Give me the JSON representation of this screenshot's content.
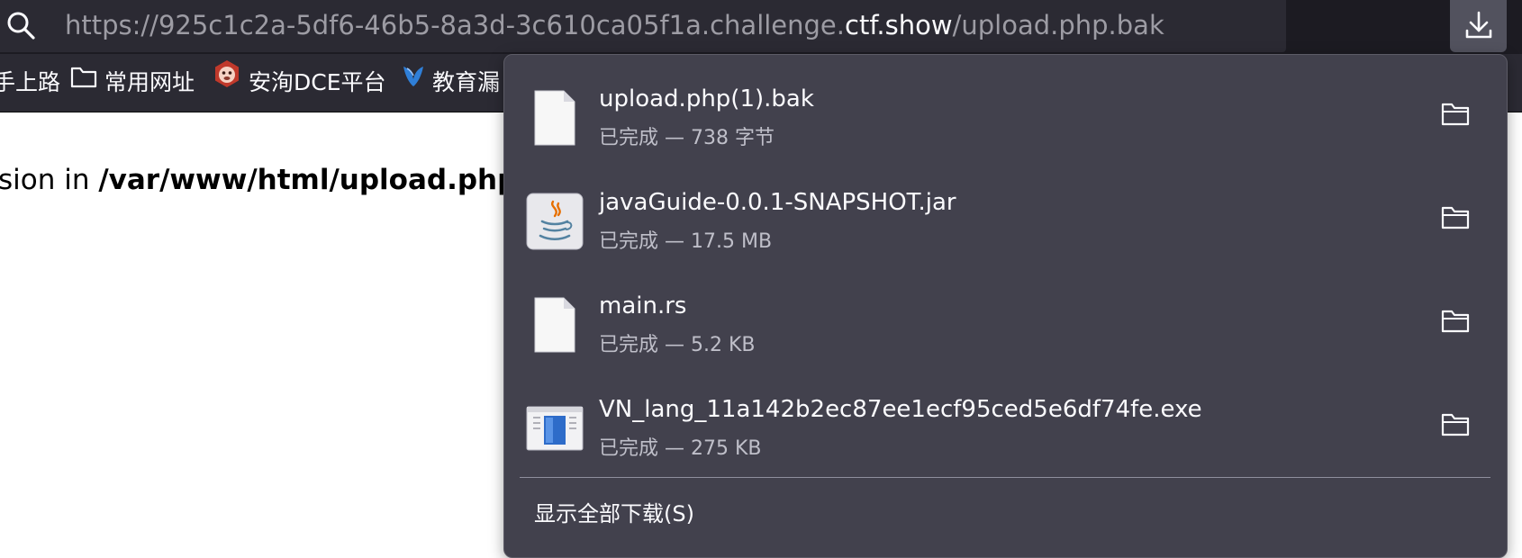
{
  "toolbar": {
    "url_prefix": "https://925c1c2a-5df6-46b5-8a3d-3c610ca05f1a.challenge.",
    "url_host": "ctf.show",
    "url_suffix": "/upload.php.bak"
  },
  "bookmarks": [
    {
      "label": "手上路",
      "icon": "none"
    },
    {
      "label": "常用网址",
      "icon": "folder-icon"
    },
    {
      "label": "安洵DCE平台",
      "icon": "monkey-logo-icon"
    },
    {
      "label": "教育漏",
      "icon": "shield-bird-icon"
    }
  ],
  "page": {
    "prefix": "sion in ",
    "path": "/var/www/html/upload.php"
  },
  "downloads": {
    "items": [
      {
        "name": "upload.php(1).bak",
        "status": "已完成 — 738 字节",
        "icon": "generic-file-icon"
      },
      {
        "name": "javaGuide-0.0.1-SNAPSHOT.jar",
        "status": "已完成 — 17.5 MB",
        "icon": "java-file-icon"
      },
      {
        "name": "main.rs",
        "status": "已完成 — 5.2 KB",
        "icon": "generic-file-icon"
      },
      {
        "name": "VN_lang_11a142b2ec87ee1ecf95ced5e6df74fe.exe",
        "status": "已完成 — 275 KB",
        "icon": "exe-file-icon"
      }
    ],
    "show_all": "显示全部下载(S)"
  },
  "colors": {
    "toolbar_bg": "#1c1b22",
    "url_bg": "#2b2a33",
    "panel_bg": "#42414d",
    "text_primary": "#fbfbfe",
    "text_secondary": "#bfbfc9"
  }
}
